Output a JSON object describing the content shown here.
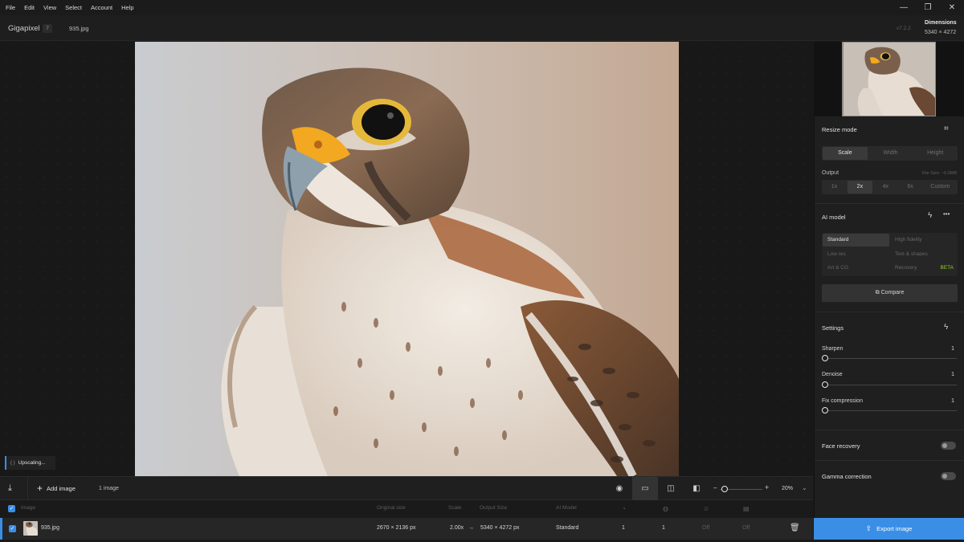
{
  "menu": [
    "File",
    "Edit",
    "View",
    "Select",
    "Account",
    "Help"
  ],
  "window_controls": {
    "minimize": "—",
    "restore": "❐",
    "close": "✕"
  },
  "header": {
    "app_name": "Gigapixel",
    "app_badge": "7",
    "file_tab": "935.jpg",
    "version": "v7.2.2",
    "dimensions_label": "Dimensions",
    "dimensions_value": "5340 × 4272"
  },
  "status": {
    "spinner": "( )",
    "text": "Upscaling..."
  },
  "panel": {
    "resize_mode": {
      "title": "Resize mode",
      "options": [
        "Scale",
        "Width",
        "Height"
      ],
      "active": "Scale"
    },
    "output": {
      "label": "Output",
      "file_size": "File Size: ~6.0MB",
      "options": [
        "1x",
        "2x",
        "4x",
        "6x",
        "Custom"
      ],
      "active": "2x"
    },
    "ai_model": {
      "title": "AI model",
      "more": "•••",
      "models": [
        "Standard",
        "High fidelity",
        "Low res",
        "Text & shapes",
        "Art & CG",
        "Recovery"
      ],
      "active": "Standard",
      "beta": "BETA",
      "compare": "Compare"
    },
    "settings": {
      "title": "Settings",
      "sliders": [
        {
          "label": "Sharpen",
          "value": "1"
        },
        {
          "label": "Denoise",
          "value": "1"
        },
        {
          "label": "Fix compression",
          "value": "1"
        }
      ]
    },
    "face_recovery": "Face recovery",
    "gamma_correction": "Gamma correction"
  },
  "toolbar": {
    "add_image": "Add image",
    "count": "1 image",
    "zoom": "20%"
  },
  "list": {
    "headers": {
      "image": "Image",
      "original_size": "Original size",
      "scale": "Scale",
      "output_size": "Output Size",
      "ai_model": "AI Model"
    },
    "row": {
      "name": "935.jpg",
      "original_size": "2670 × 2136 px",
      "scale": "2.00x",
      "arrow": "→",
      "output_size": "5340 × 4272 px",
      "ai_model": "Standard",
      "sharpen": "1",
      "denoise": "1",
      "face": "Off",
      "gamma": "Off"
    }
  },
  "export_button": "Export image"
}
